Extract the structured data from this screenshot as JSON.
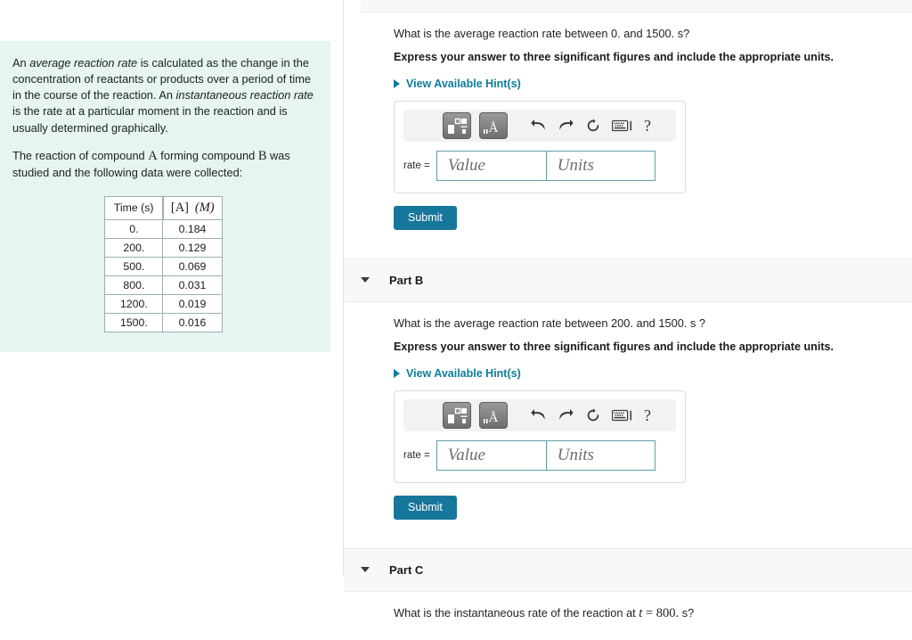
{
  "intro": {
    "paragraph1_a": "An ",
    "paragraph1_em1": "average reaction rate",
    "paragraph1_b": " is calculated as the change in the concentration of reactants or products over a period of time in the course of the reaction. An ",
    "paragraph1_em2": "instantaneous reaction rate",
    "paragraph1_c": " is the rate at a particular moment in the reaction and is usually determined graphically.",
    "paragraph2_a": "The reaction of compound ",
    "paragraph2_var1": "A",
    "paragraph2_b": " forming compound ",
    "paragraph2_var2": "B",
    "paragraph2_c": " was studied and the following data were collected:"
  },
  "data_table": {
    "headers": [
      "Time (s)",
      "[A]  (M)"
    ],
    "header_time": "Time (s)",
    "header_conc_bracket": "[A]",
    "header_conc_unit": "(M)",
    "rows": [
      {
        "time": "0.",
        "conc": "0.184"
      },
      {
        "time": "200.",
        "conc": "0.129"
      },
      {
        "time": "500.",
        "conc": "0.069"
      },
      {
        "time": "800.",
        "conc": "0.031"
      },
      {
        "time": "1200.",
        "conc": "0.019"
      },
      {
        "time": "1500.",
        "conc": "0.016"
      }
    ]
  },
  "part_a": {
    "question": "What is the average reaction rate between 0. and 1500. s?",
    "instruction": "Express your answer to three significant figures and include the appropriate units.",
    "hint_label": "View Available Hint(s)",
    "rate_label": "rate =",
    "value_placeholder": "Value",
    "units_placeholder": "Units",
    "submit_label": "Submit",
    "help_glyph": "?"
  },
  "part_b": {
    "title": "Part B",
    "question": "What is the average reaction rate between 200. and 1500. s ?",
    "instruction": "Express your answer to three significant figures and include the appropriate units.",
    "hint_label": "View Available Hint(s)",
    "rate_label": "rate =",
    "value_placeholder": "Value",
    "units_placeholder": "Units",
    "submit_label": "Submit",
    "help_glyph": "?"
  },
  "part_c": {
    "title": "Part C",
    "question_a": "What is the instantaneous rate of the reaction at ",
    "question_var": "t",
    "question_eq": " = ",
    "question_val": "800.",
    "question_b": " s?"
  },
  "icons": {
    "template_tile": "math-template-icon",
    "units_tile": "units-angstrom-icon",
    "undo": "undo-icon",
    "redo": "redo-icon",
    "reset": "reset-icon",
    "keyboard": "keyboard-icon",
    "help": "help-icon"
  },
  "colors": {
    "accent_teal": "#17769b",
    "link_teal": "#0e7c9b",
    "panel_mint": "#e6f4f2",
    "field_border": "#5f9ea8"
  }
}
